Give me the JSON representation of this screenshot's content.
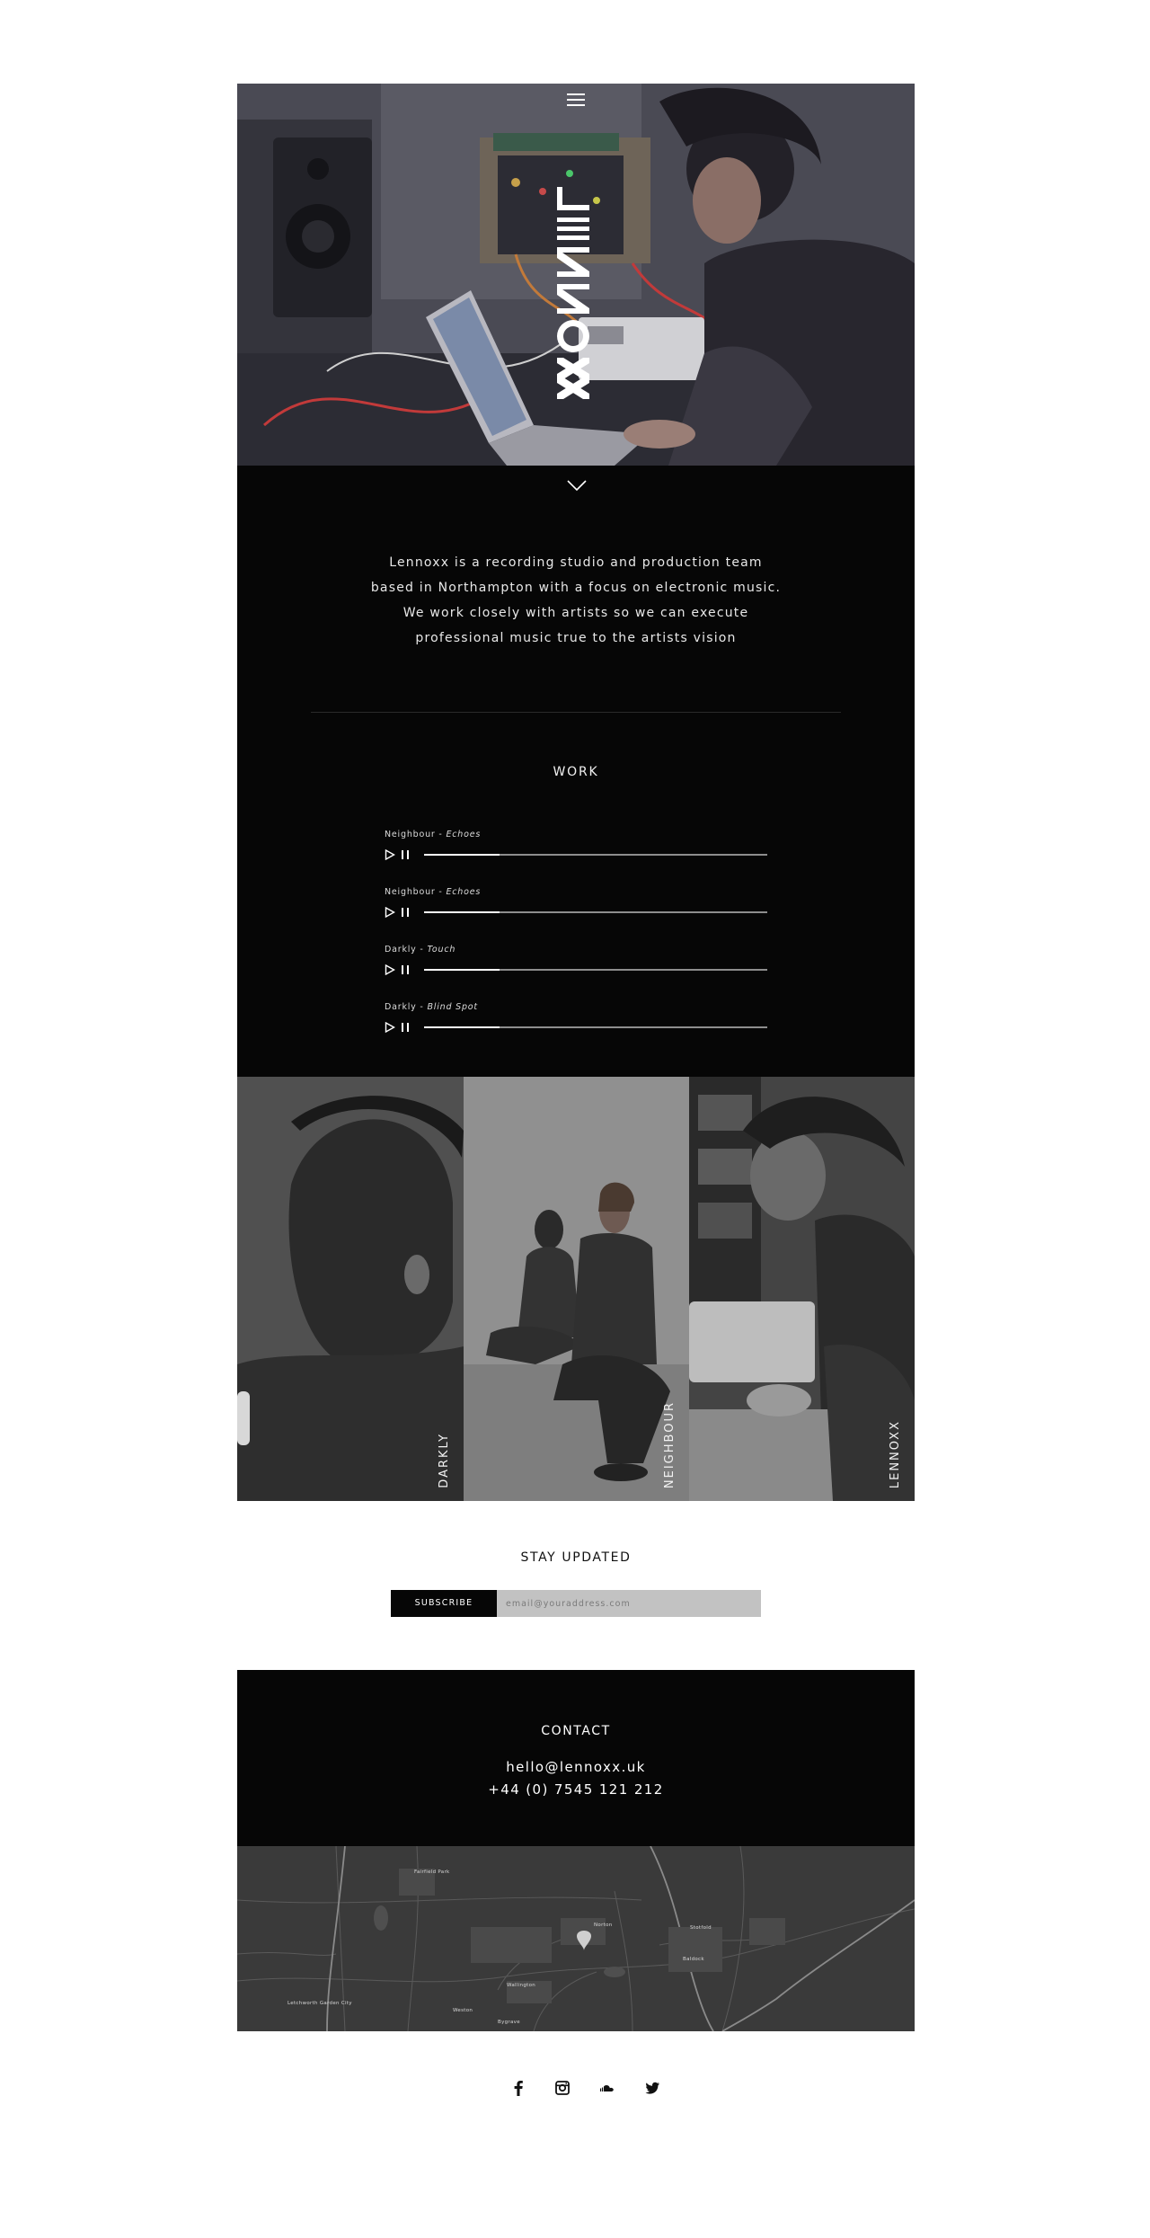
{
  "hero": {
    "menu_icon": "hamburger-menu-icon",
    "logo_text": "LENNOXX"
  },
  "scroll_icon": "chevron-down-icon",
  "intro": {
    "lines": [
      "Lennoxx is a recording studio and production team",
      "based in Northampton with a focus on electronic music.",
      "We work closely with artists so we can execute",
      "professional music true to the artists vision"
    ]
  },
  "work": {
    "heading": "WORK",
    "tracks": [
      {
        "artist": "Neighbour - ",
        "title": "Echoes",
        "progress": 0.22
      },
      {
        "artist": "Neighbour - ",
        "title": "Echoes",
        "progress": 0.22
      },
      {
        "artist": "Darkly - ",
        "title": "Touch",
        "progress": 0.22
      },
      {
        "artist": "Darkly - ",
        "title": "Blind Spot",
        "progress": 0.22
      }
    ],
    "play_icon": "play-icon",
    "pause_icon": "pause-icon"
  },
  "artists": [
    {
      "name": "DARKLY"
    },
    {
      "name": "NEIGHBOUR"
    },
    {
      "name": "LENNOXX"
    }
  ],
  "subscribe": {
    "heading": "STAY UPDATED",
    "button_label": "SUBSCRIBE",
    "input_placeholder": "email@youraddress.com",
    "input_value": ""
  },
  "contact": {
    "heading": "CONTACT",
    "email": "hello@lennoxx.uk",
    "phone": "+44 (0) 7545 121 212"
  },
  "map": {
    "labels": [
      "Fairfield Park",
      "Norton",
      "Baldock",
      "Stotfold",
      "Letchworth Garden City",
      "Wallington",
      "Weston",
      "Bygrave"
    ]
  },
  "social": {
    "icons": [
      "facebook-icon",
      "instagram-icon",
      "soundcloud-icon",
      "twitter-icon"
    ]
  },
  "colors": {
    "background": "#ffffff",
    "dark_section": "#060606",
    "hero_tint": "#4b4b55",
    "input_bg": "#c2c2c2",
    "map_bg": "#3b3b3b"
  }
}
